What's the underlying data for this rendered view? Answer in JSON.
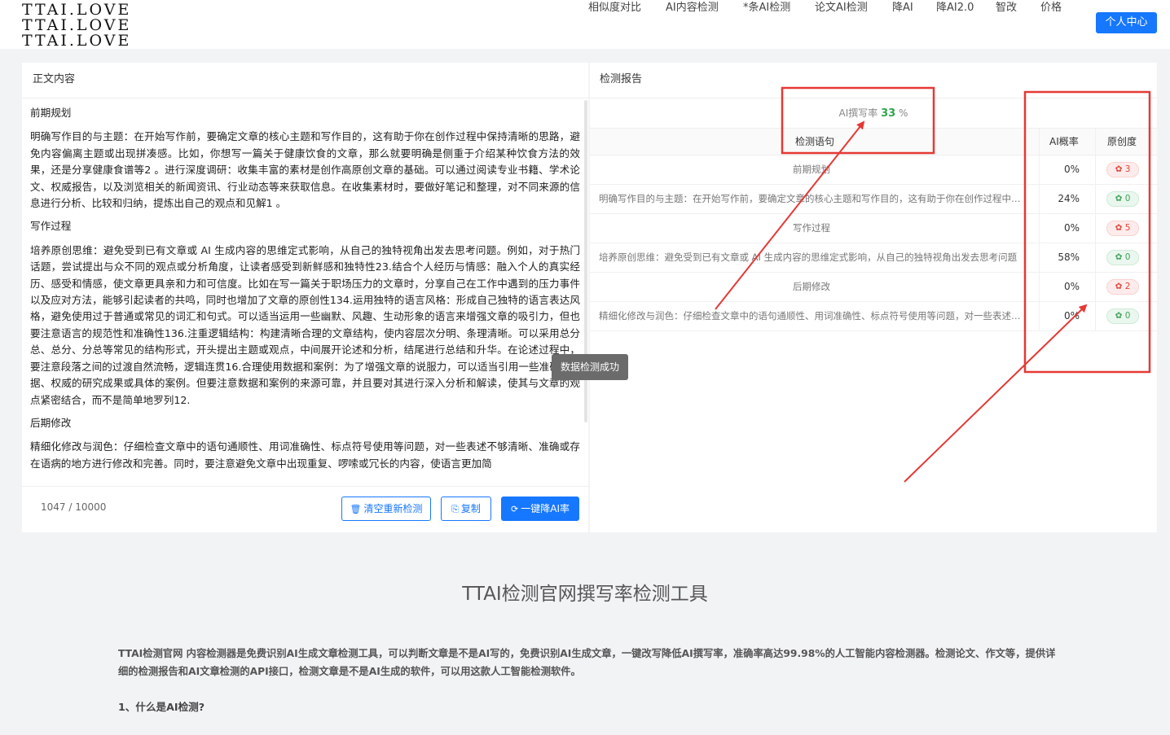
{
  "header": {
    "logo_lines": [
      "TTAI.LOVE",
      "TTAI.LOVE",
      "TTAI.LOVE"
    ],
    "nav": [
      "相似度对比",
      "AI内容检测",
      "*条AI检测",
      "论文AI检测",
      "降AI",
      "降AI2.0",
      "智改",
      "价格"
    ],
    "user_center": "个人中心"
  },
  "left": {
    "title": "正文内容",
    "sections": [
      {
        "heading": "前期规划",
        "body": "明确写作目的与主题：在开始写作前，要确定文章的核心主题和写作目的，这有助于你在创作过程中保持清晰的思路，避免内容偏离主题或出现拼凑感。比如，你想写一篇关于健康饮食的文章，那么就要明确是侧重于介绍某种饮食方法的效果，还是分享健康食谱等2 。进行深度调研：收集丰富的素材是创作高原创文章的基础。可以通过阅读专业书籍、学术论文、权威报告，以及浏览相关的新闻资讯、行业动态等来获取信息。在收集素材时，要做好笔记和整理，对不同来源的信息进行分析、比较和归纳，提炼出自己的观点和见解1 。"
      },
      {
        "heading": "写作过程",
        "body": "培养原创思维：避免受到已有文章或 AI 生成内容的思维定式影响，从自己的独特视角出发去思考问题。例如，对于热门话题，尝试提出与众不同的观点或分析角度，让读者感受到新鲜感和独特性23.结合个人经历与情感：融入个人的真实经历、感受和情感，使文章更具亲和力和可信度。比如在写一篇关于职场压力的文章时，分享自己在工作中遇到的压力事件以及应对方法，能够引起读者的共鸣，同时也增加了文章的原创性134.运用独特的语言风格：形成自己独特的语言表达风格，避免使用过于普通或常见的词汇和句式。可以适当运用一些幽默、风趣、生动形象的语言来增强文章的吸引力，但也要注意语言的规范性和准确性136.注重逻辑结构：构建清晰合理的文章结构，使内容层次分明、条理清晰。可以采用总分总、总分、分总等常见的结构形式，开头提出主题或观点，中间展开论述和分析，结尾进行总结和升华。在论述过程中，要注意段落之间的过渡自然流畅，逻辑连贯16.合理使用数据和案例：为了增强文章的说服力，可以适当引用一些准确的数据、权威的研究成果或具体的案例。但要注意数据和案例的来源可靠，并且要对其进行深入分析和解读，使其与文章的观点紧密结合，而不是简单地罗列12."
      },
      {
        "heading": "后期修改",
        "body": "精细化修改与润色：仔细检查文章中的语句通顺性、用词准确性、标点符号使用等问题，对一些表述不够清晰、准确或存在语病的地方进行修改和完善。同时，要注意避免文章中出现重复、啰嗦或冗长的内容，使语言更加简"
      }
    ],
    "count": "1047 / 10000",
    "btn_clear": "清空重新检测",
    "btn_copy": "复制",
    "btn_reduce": "一键降AI率"
  },
  "right": {
    "title": "检测报告",
    "rate_label": "AI撰写率",
    "rate_value": "33",
    "rate_unit": "%",
    "col_sentence": "检测语句",
    "col_prob": "AI概率",
    "col_orig": "原创度",
    "rows": [
      {
        "text": "前期规划",
        "prob": "0%",
        "badge": "3",
        "status": "red",
        "center": true
      },
      {
        "text": "明确写作目的与主题：在开始写作前，要确定文章的核心主题和写作目的，这有助于你在创作过程中保持清晰的思路",
        "prob": "24%",
        "badge": "0",
        "status": "green",
        "center": false
      },
      {
        "text": "写作过程",
        "prob": "0%",
        "badge": "5",
        "status": "red",
        "center": true
      },
      {
        "text": "培养原创思维：避免受到已有文章或 AI 生成内容的思维定式影响，从自己的独特视角出发去思考问题",
        "prob": "58%",
        "badge": "0",
        "status": "green",
        "center": false
      },
      {
        "text": "后期修改",
        "prob": "0%",
        "badge": "2",
        "status": "red",
        "center": true
      },
      {
        "text": "精细化修改与润色：仔细检查文章中的语句通顺性、用词准确性、标点符号使用等问题，对一些表述不够清晰",
        "prob": "0%",
        "badge": "0",
        "status": "green",
        "center": false
      }
    ]
  },
  "toast": "数据检测成功",
  "bottom": {
    "title": "TTAI检测官网撰写率检测工具",
    "desc": "TTAI检测官网 内容检测器是免费识别AI生成文章检测工具，可以判断文章是不是AI写的，免费识别AI生成文章，一键改写降低AI撰写率，准确率高达99.98%的人工智能内容检测器。检测论文、作文等，提供详细的检测报告和AI文章检测的API接口，检测文章是不是AI生成的软件，可以用这款人工智能检测软件。",
    "q1": "1、什么是AI检测?"
  },
  "colors": {
    "accent": "#1677ff",
    "annotation": "#e53935",
    "green": "#2ba64c",
    "red": "#e0463b"
  }
}
